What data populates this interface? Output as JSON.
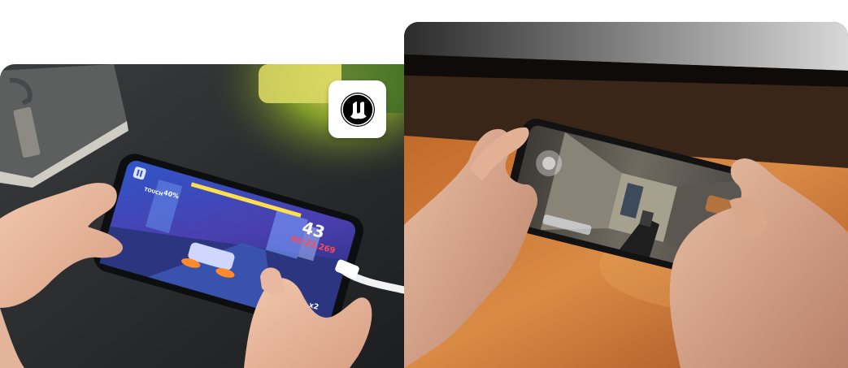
{
  "badge": {
    "icon": "unreal-engine-logo-icon"
  },
  "left_photo": {
    "hud": {
      "pause_icon": "pause-icon",
      "score_primary": "43",
      "score_secondary": "00:22.269",
      "rank_label": "x2",
      "percent": "40%",
      "chip": "TOUCH"
    }
  },
  "right_photo": {
    "hud": {}
  }
}
